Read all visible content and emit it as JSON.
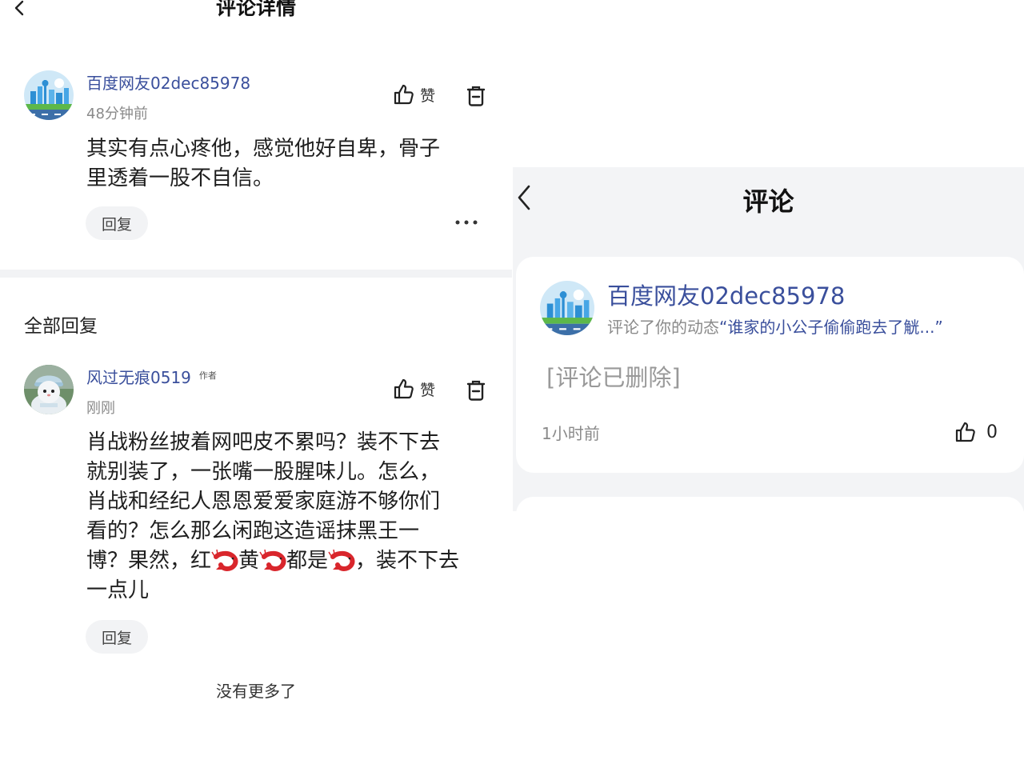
{
  "left": {
    "title": "评论详情",
    "comment": {
      "username": "百度网友02dec85978",
      "time": "48分钟前",
      "text_line1": "其实有点心疼他，感觉他好自卑，骨子",
      "text_line2": "里透着一股不自信。",
      "like_label": "赞",
      "reply_label": "回复",
      "more": "···"
    },
    "section_title": "全部回复",
    "reply": {
      "username": "风过无痕0519",
      "badge": "作者",
      "time": "刚刚",
      "lines": [
        "肖战粉丝披着网吧皮不累吗？装不下去",
        "就别装了，一张嘴一股腥味儿。怎么，",
        "肖战和经纪人恩恩爱爱家庭游不够你们",
        "看的？怎么那么闲跑这造谣抹黑王一"
      ],
      "line5_a": "博？果然，红",
      "line5_b": "黄",
      "line5_c": "都是",
      "line5_d": "，装不下去",
      "line6": "一点儿",
      "like_label": "赞",
      "reply_label": "回复"
    },
    "no_more": "没有更多了"
  },
  "right": {
    "title": "评论",
    "username": "百度网友02dec85978",
    "desc_prefix": "评论了你的动态",
    "desc_quote": "“谁家的小公子偷偷跑去了觥...”",
    "deleted": "[评论已删除]",
    "time": "1小时前",
    "like_count": "0"
  },
  "colors": {
    "link_blue": "#3a4f9c",
    "gray_text": "#8a8a8a",
    "panel_bg": "#f3f4f6",
    "shrimp_red": "#d9262c"
  },
  "icons": [
    "back-arrow-icon",
    "thumbs-up-icon",
    "trash-icon",
    "more-icon",
    "shrimp-emoji-icon"
  ]
}
